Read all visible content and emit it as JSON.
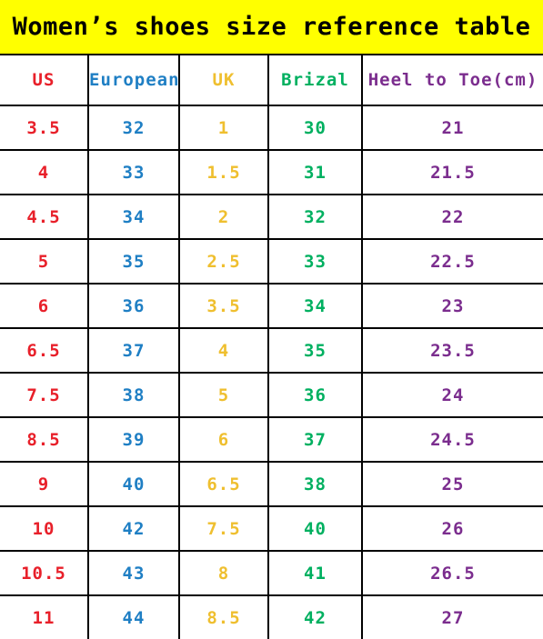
{
  "title": "Women’s shoes size reference table",
  "colors": {
    "banner_background": "#ffff00",
    "title_text": "#000000",
    "grid_line": "#000000",
    "cell_background": "#ffffff",
    "us": "#e8202a",
    "european": "#1f7fc4",
    "uk": "#efbf2f",
    "brizal": "#00b060",
    "heel_to_toe": "#7b2d8e"
  },
  "table": {
    "columns": [
      {
        "key": "us",
        "label": "US",
        "color": "#e8202a"
      },
      {
        "key": "european",
        "label": "European",
        "color": "#1f7fc4"
      },
      {
        "key": "uk",
        "label": "UK",
        "color": "#efbf2f"
      },
      {
        "key": "brizal",
        "label": "Brizal",
        "color": "#00b060"
      },
      {
        "key": "heel_to_toe",
        "label": "Heel to Toe(cm)",
        "color": "#7b2d8e"
      }
    ],
    "rows": [
      {
        "us": "3.5",
        "european": "32",
        "uk": "1",
        "brizal": "30",
        "heel_to_toe": "21"
      },
      {
        "us": "4",
        "european": "33",
        "uk": "1.5",
        "brizal": "31",
        "heel_to_toe": "21.5"
      },
      {
        "us": "4.5",
        "european": "34",
        "uk": "2",
        "brizal": "32",
        "heel_to_toe": "22"
      },
      {
        "us": "5",
        "european": "35",
        "uk": "2.5",
        "brizal": "33",
        "heel_to_toe": "22.5"
      },
      {
        "us": "6",
        "european": "36",
        "uk": "3.5",
        "brizal": "34",
        "heel_to_toe": "23"
      },
      {
        "us": "6.5",
        "european": "37",
        "uk": "4",
        "brizal": "35",
        "heel_to_toe": "23.5"
      },
      {
        "us": "7.5",
        "european": "38",
        "uk": "5",
        "brizal": "36",
        "heel_to_toe": "24"
      },
      {
        "us": "8.5",
        "european": "39",
        "uk": "6",
        "brizal": "37",
        "heel_to_toe": "24.5"
      },
      {
        "us": "9",
        "european": "40",
        "uk": "6.5",
        "brizal": "38",
        "heel_to_toe": "25"
      },
      {
        "us": "10",
        "european": "42",
        "uk": "7.5",
        "brizal": "40",
        "heel_to_toe": "26"
      },
      {
        "us": "10.5",
        "european": "43",
        "uk": "8",
        "brizal": "41",
        "heel_to_toe": "26.5"
      },
      {
        "us": "11",
        "european": "44",
        "uk": "8.5",
        "brizal": "42",
        "heel_to_toe": "27"
      }
    ]
  }
}
